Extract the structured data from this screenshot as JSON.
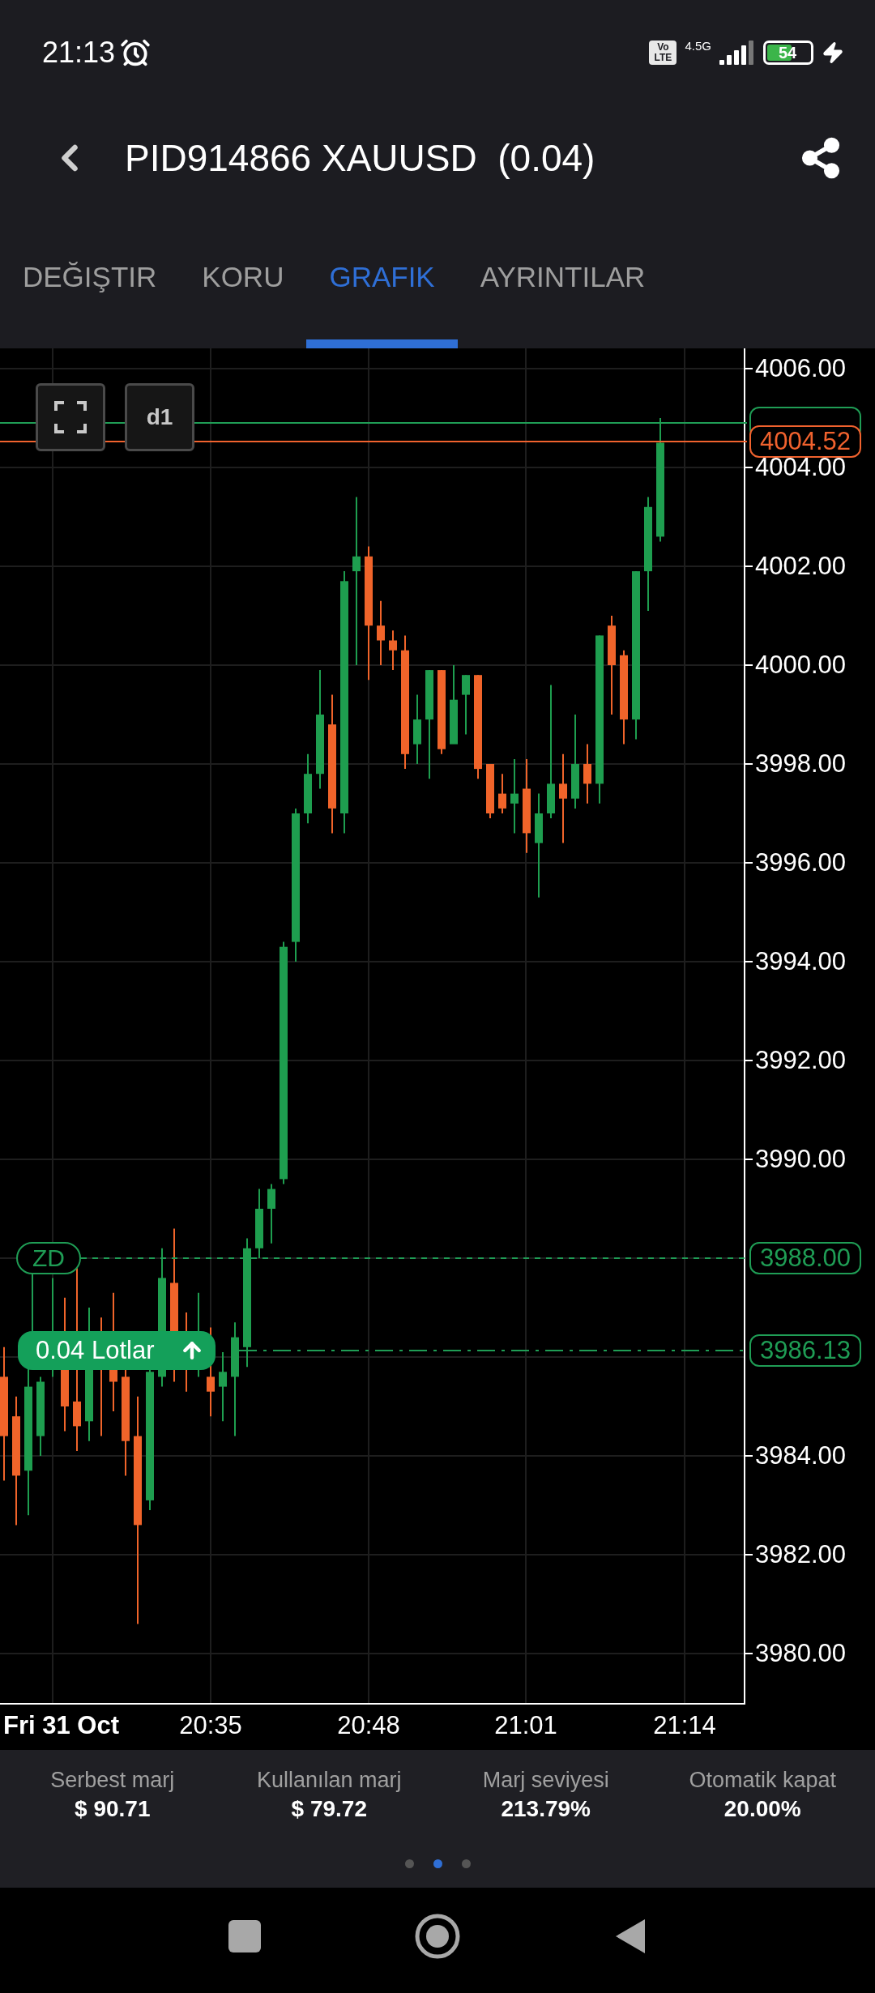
{
  "status_bar": {
    "time": "21:13",
    "volte": "Vo LTE",
    "network": "4.5G",
    "battery": "54"
  },
  "header": {
    "title": "PID914866 XAUUSD  (0.04)"
  },
  "tabs": [
    {
      "label": "DEĞIŞTIR",
      "selected": false
    },
    {
      "label": "KORU",
      "selected": false
    },
    {
      "label": "GRAFIK",
      "selected": true
    },
    {
      "label": "AYRINTILAR",
      "selected": false
    }
  ],
  "chart": {
    "timeframe": "d1",
    "price_ticks": [
      "4006.00",
      "4004.00",
      "4002.00",
      "4000.00",
      "3998.00",
      "3996.00",
      "3994.00",
      "3992.00",
      "3990.00",
      "3984.00",
      "3982.00",
      "3980.00"
    ],
    "price_markers": [
      {
        "color": "#1f9d55"
      },
      {
        "label": "4004.52",
        "color": "#f0622e"
      }
    ],
    "levels": [
      {
        "kind": "stop",
        "label": "ZD",
        "price_label": "3988.00"
      },
      {
        "kind": "entry",
        "label": "0.04 Lotlar",
        "price_label": "3986.13"
      }
    ],
    "time_labels": [
      {
        "kind": "date",
        "label": "Fri 31 Oct"
      },
      {
        "kind": "time",
        "label": "20:35"
      },
      {
        "kind": "time",
        "label": "20:48"
      },
      {
        "kind": "time",
        "label": "21:01"
      },
      {
        "kind": "time",
        "label": "21:14"
      }
    ]
  },
  "margin_panel": {
    "items": [
      {
        "label": "Serbest marj",
        "value": "$ 90.71"
      },
      {
        "label": "Kullanılan marj",
        "value": "$ 79.72"
      },
      {
        "label": "Marj seviyesi",
        "value": "213.79%"
      },
      {
        "label": "Otomatik kapat",
        "value": "20.00%"
      }
    ],
    "pages": [
      {
        "selected": false
      },
      {
        "selected": true
      },
      {
        "selected": false
      }
    ]
  }
}
